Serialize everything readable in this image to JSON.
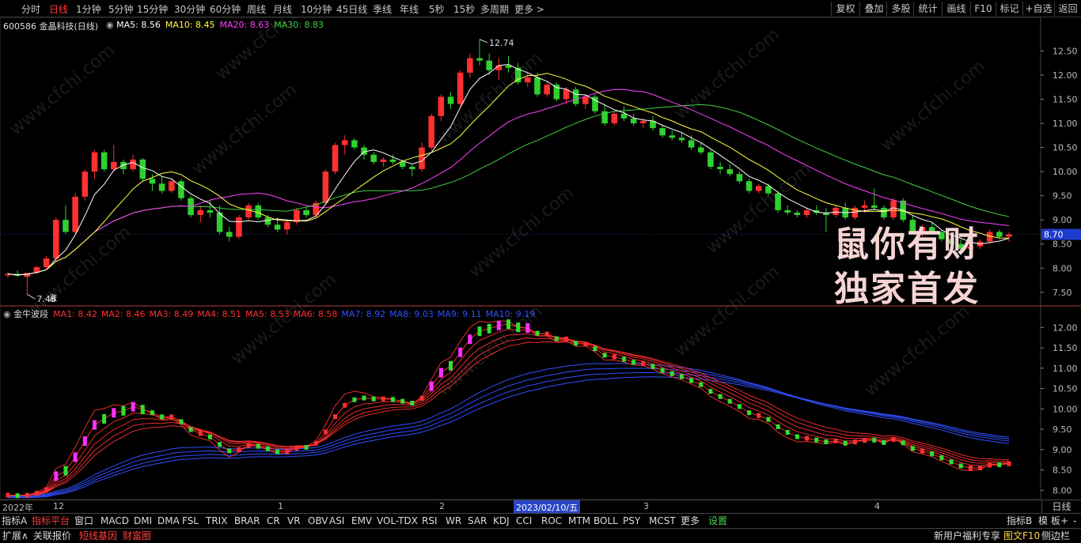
{
  "toolbar": {
    "periods": [
      "分时",
      "日线",
      "1分钟",
      "5分钟",
      "15分钟",
      "30分钟",
      "60分钟",
      "周线",
      "月线",
      "10分钟",
      "45日线",
      "季线",
      "年线",
      "5秒",
      "15秒",
      "多周期",
      "更多 >"
    ],
    "active_period": "日线",
    "tools": [
      "复权",
      "叠加",
      "多股",
      "统计",
      "画线",
      "F10",
      "标记",
      "+自选",
      "返回"
    ]
  },
  "main_chart": {
    "title": "600586 金晶科技(日线)",
    "ma_legend": [
      {
        "label": "MA5: 8.56",
        "color": "#ffffff"
      },
      {
        "label": "MA10: 8.45",
        "color": "#ffff40"
      },
      {
        "label": "MA20: 8.63",
        "color": "#ff40ff"
      },
      {
        "label": "MA30: 8.83",
        "color": "#40d040"
      }
    ],
    "high_marker": "12.74",
    "low_marker": "7.46",
    "up_badge": "涨",
    "price_ticks": [
      "12.50",
      "12.00",
      "11.50",
      "11.00",
      "10.50",
      "10.00",
      "9.50",
      "9.00",
      "8.50",
      "8.00",
      "7.50"
    ],
    "last_price": "8.70"
  },
  "sub_chart": {
    "title": "金牛波段",
    "legend": [
      {
        "label": "MA1: 8.42",
        "color": "#ff3030"
      },
      {
        "label": "MA2: 8.46",
        "color": "#ff3030"
      },
      {
        "label": "MA3: 8.49",
        "color": "#ff3030"
      },
      {
        "label": "MA4: 8.51",
        "color": "#ff3030"
      },
      {
        "label": "MA5: 8.53",
        "color": "#ff3030"
      },
      {
        "label": "MA6: 8.58",
        "color": "#ff3030"
      },
      {
        "label": "MA7: 8.92",
        "color": "#3050ff"
      },
      {
        "label": "MA8: 9.03",
        "color": "#3050ff"
      },
      {
        "label": "MA9: 9.11",
        "color": "#3050ff"
      },
      {
        "label": "MA10: 9.19",
        "color": "#3050ff"
      }
    ],
    "value_ticks": [
      "12.00",
      "11.50",
      "11.00",
      "10.50",
      "10.00",
      "9.50",
      "9.00",
      "8.50",
      "8.00"
    ]
  },
  "time_axis": {
    "labels": [
      {
        "text": "2022年",
        "pos": 3
      },
      {
        "text": "12",
        "pos": 67
      },
      {
        "text": "1",
        "pos": 351
      },
      {
        "text": "2",
        "pos": 555
      },
      {
        "text": "3",
        "pos": 813
      },
      {
        "text": "4",
        "pos": 1105
      }
    ],
    "crosshair_date": "2023/02/10/五",
    "period_button": "日线"
  },
  "indicator_tabs": [
    "指标A",
    "指标平台",
    "窗口",
    "MACD",
    "DMI",
    "DMA",
    "FSL",
    "TRIX",
    "BRAR",
    "CR",
    "VR",
    "OBV",
    "ASI",
    "EMV",
    "VOL-TDX",
    "RSI",
    "WR",
    "SAR",
    "KDJ",
    "CCI",
    "ROC",
    "MTM",
    "BOLL",
    "PSY",
    "MCST",
    "更多",
    "设置"
  ],
  "indicator_tabs_selected": "指标平台",
  "indicator_right": [
    "指标B",
    "模 板",
    "+",
    "-"
  ],
  "status_bar": {
    "left": [
      "扩展∧",
      "关联报价",
      "短线基因",
      "财富圈"
    ],
    "right": [
      "新用户福利专享",
      "图文F10",
      "侧边栏 《"
    ]
  },
  "watermark_banner": [
    "鼠你有财",
    "独家首发"
  ],
  "background_watermark": "www.cfchi.com",
  "colors": {
    "up": "#ff3030",
    "down": "#30d030",
    "ma5": "#ffffff",
    "ma10": "#ffff40",
    "ma20": "#ff40ff",
    "ma30": "#40d040",
    "blue_band": "#3050ff",
    "last_price_bg": "#1e3ccc"
  },
  "chart_data": {
    "type": "candlestick",
    "title": "600586 金晶科技(日线)",
    "x_labels": [
      "2022年",
      "12",
      "1",
      "2",
      "3",
      "4"
    ],
    "ylim": [
      7.3,
      12.9
    ],
    "ohlc": [
      [
        7.85,
        7.92,
        7.8,
        7.88
      ],
      [
        7.88,
        7.95,
        7.82,
        7.84
      ],
      [
        7.82,
        7.86,
        7.46,
        7.9
      ],
      [
        7.9,
        8.05,
        7.88,
        8.02
      ],
      [
        8.02,
        8.25,
        7.98,
        8.2
      ],
      [
        8.2,
        9.05,
        8.15,
        9.0
      ],
      [
        9.0,
        9.3,
        8.7,
        8.75
      ],
      [
        8.75,
        9.55,
        8.7,
        9.48
      ],
      [
        9.48,
        10.05,
        9.4,
        10.0
      ],
      [
        10.0,
        10.45,
        9.85,
        10.4
      ],
      [
        10.4,
        10.45,
        10.0,
        10.05
      ],
      [
        10.05,
        10.55,
        10.0,
        10.2
      ],
      [
        10.2,
        10.25,
        9.95,
        10.05
      ],
      [
        10.05,
        10.35,
        10.0,
        10.25
      ],
      [
        10.25,
        10.28,
        9.8,
        9.85
      ],
      [
        9.85,
        9.95,
        9.6,
        9.75
      ],
      [
        9.75,
        9.9,
        9.55,
        9.6
      ],
      [
        9.6,
        9.85,
        9.55,
        9.8
      ],
      [
        9.8,
        9.85,
        9.4,
        9.45
      ],
      [
        9.45,
        9.5,
        9.05,
        9.1
      ],
      [
        9.1,
        9.3,
        8.95,
        9.2
      ],
      [
        9.2,
        9.4,
        9.05,
        9.15
      ],
      [
        9.15,
        9.3,
        8.7,
        8.75
      ],
      [
        8.75,
        8.85,
        8.55,
        8.65
      ],
      [
        8.65,
        9.1,
        8.6,
        9.05
      ],
      [
        9.05,
        9.35,
        9.0,
        9.3
      ],
      [
        9.3,
        9.35,
        9.0,
        9.05
      ],
      [
        9.05,
        9.1,
        8.85,
        8.9
      ],
      [
        8.9,
        9.05,
        8.75,
        8.8
      ],
      [
        8.8,
        9.0,
        8.7,
        8.95
      ],
      [
        8.95,
        9.25,
        8.9,
        9.2
      ],
      [
        9.2,
        9.25,
        9.05,
        9.1
      ],
      [
        9.1,
        9.4,
        9.05,
        9.35
      ],
      [
        9.35,
        10.05,
        9.3,
        10.0
      ],
      [
        10.0,
        10.6,
        9.95,
        10.55
      ],
      [
        10.55,
        10.75,
        10.35,
        10.65
      ],
      [
        10.65,
        10.7,
        10.45,
        10.5
      ],
      [
        10.5,
        10.55,
        10.25,
        10.35
      ],
      [
        10.35,
        10.4,
        10.15,
        10.2
      ],
      [
        10.2,
        10.3,
        10.1,
        10.25
      ],
      [
        10.25,
        10.35,
        10.15,
        10.2
      ],
      [
        10.2,
        10.25,
        10.05,
        10.1
      ],
      [
        10.1,
        10.15,
        9.9,
        10.05
      ],
      [
        10.05,
        10.6,
        10.0,
        10.5
      ],
      [
        10.5,
        11.2,
        10.45,
        11.15
      ],
      [
        11.15,
        11.6,
        11.05,
        11.55
      ],
      [
        11.55,
        11.65,
        11.3,
        11.4
      ],
      [
        11.4,
        12.1,
        11.35,
        12.05
      ],
      [
        12.05,
        12.45,
        11.95,
        12.35
      ],
      [
        12.35,
        12.74,
        12.2,
        12.3
      ],
      [
        12.3,
        12.45,
        12.0,
        12.1
      ],
      [
        12.1,
        12.35,
        11.9,
        12.2
      ],
      [
        12.2,
        12.4,
        12.05,
        12.15
      ],
      [
        12.15,
        12.25,
        11.8,
        11.85
      ],
      [
        11.85,
        12.05,
        11.75,
        11.95
      ],
      [
        11.95,
        12.05,
        11.55,
        11.6
      ],
      [
        11.6,
        11.85,
        11.55,
        11.8
      ],
      [
        11.8,
        11.85,
        11.45,
        11.5
      ],
      [
        11.5,
        11.75,
        11.4,
        11.7
      ],
      [
        11.7,
        11.75,
        11.35,
        11.4
      ],
      [
        11.4,
        11.6,
        11.3,
        11.55
      ],
      [
        11.55,
        11.6,
        11.2,
        11.25
      ],
      [
        11.25,
        11.4,
        10.95,
        11.0
      ],
      [
        11.0,
        11.25,
        10.95,
        11.2
      ],
      [
        11.2,
        11.35,
        11.05,
        11.1
      ],
      [
        11.1,
        11.2,
        10.95,
        11.0
      ],
      [
        11.0,
        11.1,
        10.9,
        11.05
      ],
      [
        11.05,
        11.15,
        10.85,
        10.9
      ],
      [
        10.9,
        10.95,
        10.7,
        10.75
      ],
      [
        10.75,
        10.85,
        10.65,
        10.7
      ],
      [
        10.7,
        10.8,
        10.6,
        10.65
      ],
      [
        10.65,
        10.75,
        10.45,
        10.5
      ],
      [
        10.5,
        10.6,
        10.35,
        10.4
      ],
      [
        10.4,
        10.45,
        10.05,
        10.1
      ],
      [
        10.1,
        10.2,
        9.95,
        10.05
      ],
      [
        10.05,
        10.15,
        9.9,
        9.95
      ],
      [
        9.95,
        10.0,
        9.75,
        9.8
      ],
      [
        9.8,
        9.85,
        9.55,
        9.6
      ],
      [
        9.6,
        9.75,
        9.55,
        9.7
      ],
      [
        9.7,
        9.75,
        9.5,
        9.55
      ],
      [
        9.55,
        9.6,
        9.15,
        9.2
      ],
      [
        9.2,
        9.3,
        9.1,
        9.15
      ],
      [
        9.15,
        9.2,
        9.05,
        9.1
      ],
      [
        9.1,
        9.25,
        9.05,
        9.2
      ],
      [
        9.2,
        9.3,
        9.1,
        9.15
      ],
      [
        9.15,
        9.25,
        8.75,
        9.1
      ],
      [
        9.1,
        9.3,
        9.05,
        9.25
      ],
      [
        9.25,
        9.35,
        9.0,
        9.05
      ],
      [
        9.05,
        9.3,
        9.0,
        9.25
      ],
      [
        9.25,
        9.4,
        9.15,
        9.3
      ],
      [
        9.3,
        9.65,
        9.2,
        9.25
      ],
      [
        9.25,
        9.3,
        9.0,
        9.05
      ],
      [
        9.05,
        9.45,
        9.0,
        9.4
      ],
      [
        9.4,
        9.45,
        8.95,
        9.0
      ],
      [
        9.0,
        9.1,
        8.7,
        8.75
      ],
      [
        8.75,
        8.9,
        8.65,
        8.85
      ],
      [
        8.85,
        8.95,
        8.7,
        8.75
      ],
      [
        8.75,
        8.8,
        8.55,
        8.6
      ],
      [
        8.6,
        8.65,
        8.45,
        8.5
      ],
      [
        8.5,
        8.6,
        8.35,
        8.4
      ],
      [
        8.4,
        8.5,
        8.35,
        8.45
      ],
      [
        8.45,
        8.6,
        8.4,
        8.55
      ],
      [
        8.55,
        8.8,
        8.5,
        8.75
      ],
      [
        8.75,
        8.8,
        8.6,
        8.65
      ],
      [
        8.65,
        8.75,
        8.55,
        8.7
      ]
    ]
  }
}
